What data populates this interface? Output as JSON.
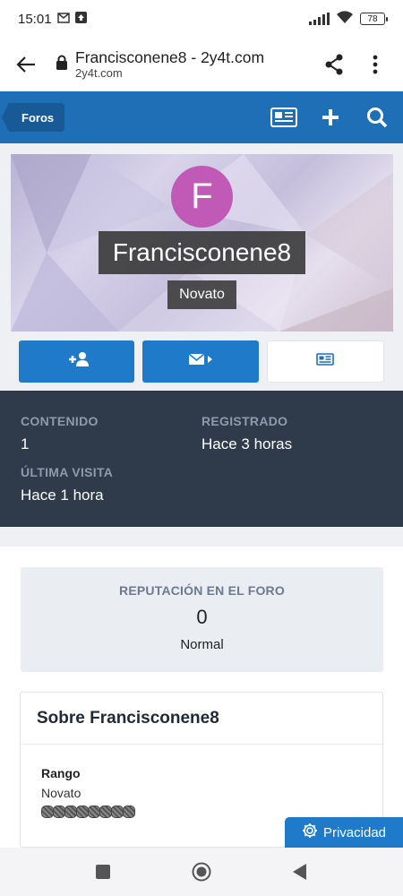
{
  "status_bar": {
    "time": "15:01",
    "battery": "78",
    "icons": [
      "gmail-icon",
      "upload-icon",
      "signal-icon",
      "wifi-icon",
      "battery-icon"
    ]
  },
  "browser": {
    "title": "Francisconene8 - 2y4t.com",
    "domain": "2y4t.com",
    "icons": [
      "back-arrow-icon",
      "lock-icon",
      "share-icon",
      "more-vert-icon"
    ]
  },
  "forum_nav": {
    "breadcrumb": "Foros",
    "icons": [
      "news-icon",
      "plus-icon",
      "search-icon"
    ],
    "color": "#1f6fb6"
  },
  "profile": {
    "avatar_letter": "F",
    "avatar_color": "#c159b6",
    "username": "Francisconene8",
    "user_title": "Novato",
    "actions": [
      "add-friend-icon",
      "send-message-icon",
      "news-icon"
    ]
  },
  "stats": {
    "content_label": "CONTENIDO",
    "content_value": "1",
    "registered_label": "REGISTRADO",
    "registered_value": "Hace 3 horas",
    "last_visit_label": "ÚLTIMA VISITA",
    "last_visit_value": "Hace 1 hora"
  },
  "reputation": {
    "title": "REPUTACIÓN EN EL FORO",
    "value": "0",
    "level": "Normal"
  },
  "about": {
    "heading": "Sobre Francisconene8",
    "rank_label": "Rango",
    "rank_value": "Novato",
    "rank_pips": 8
  },
  "privacy": {
    "label": "Privacidad",
    "icon": "gear-icon"
  },
  "system_nav": {
    "icons": [
      "recents-icon",
      "home-icon",
      "back-icon"
    ]
  }
}
